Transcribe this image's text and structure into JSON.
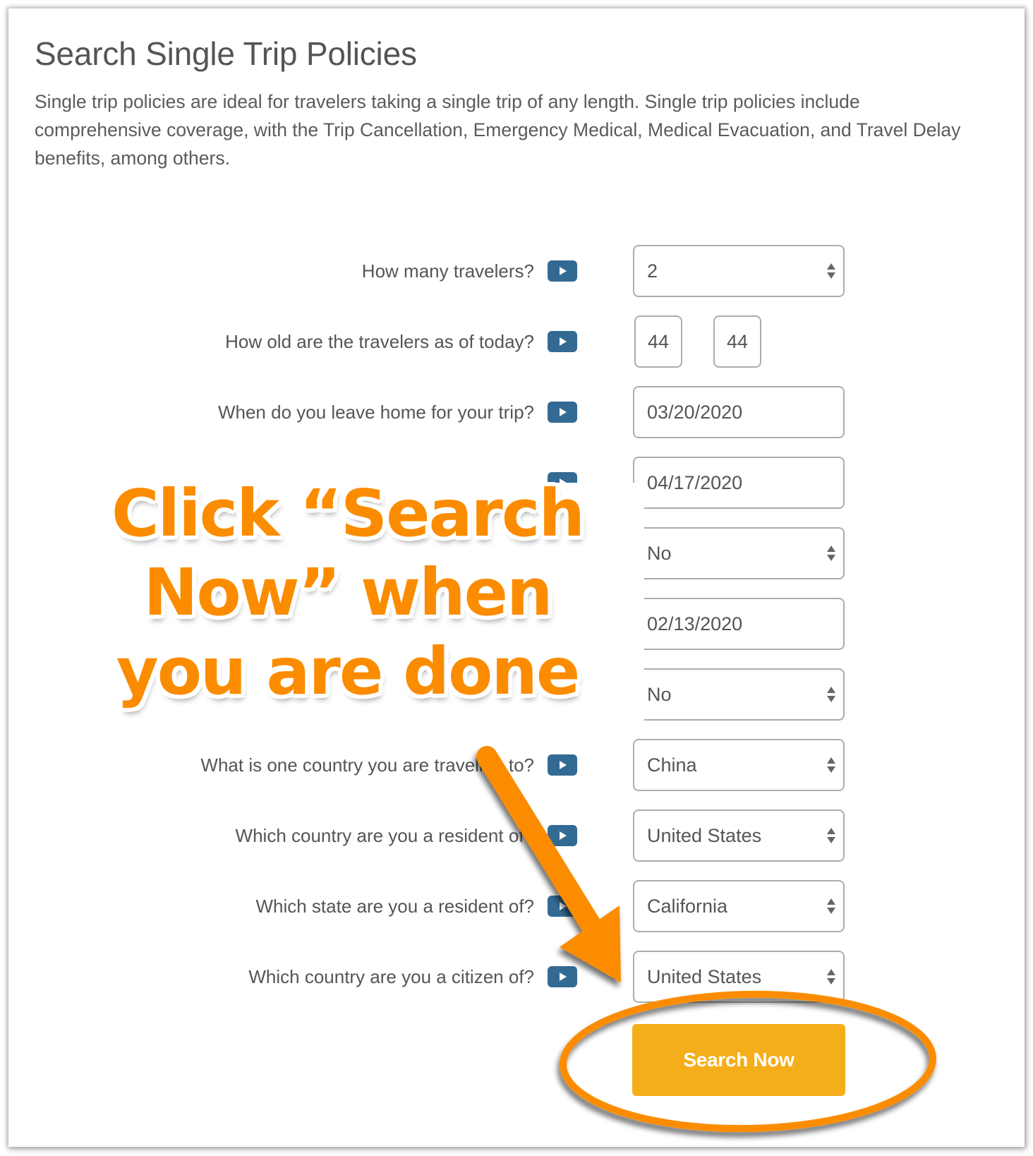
{
  "page": {
    "title": "Search Single Trip Policies",
    "description_lines": [
      "Single trip policies are ideal for travelers taking a single trip of any length. Single trip policies include",
      "comprehensive coverage, with the Trip Cancellation, Emergency Medical, Medical Evacuation, and Travel Delay",
      "benefits, among others."
    ]
  },
  "form": {
    "rows": [
      {
        "label": "How many travelers?",
        "label_visible": "How many travelers?",
        "type": "select",
        "value": "2"
      },
      {
        "label": "How old are the travelers as of today?",
        "label_visible": "How old are the travelers as of today?",
        "type": "ages",
        "values": [
          "44",
          "44"
        ]
      },
      {
        "label": "When do you leave home for your trip?",
        "label_visible": "When do you leave home for your trip?",
        "type": "text",
        "value": "03/20/2020"
      },
      {
        "label": "",
        "label_visible": "",
        "type": "text",
        "value": "04/17/2020"
      },
      {
        "label": "",
        "label_visible": "",
        "type": "select",
        "value": "No"
      },
      {
        "label": "",
        "label_visible": "",
        "type": "text",
        "value": "02/13/2020"
      },
      {
        "label": "",
        "label_visible": "",
        "type": "select",
        "value": "No"
      },
      {
        "label": "What is one country you are traveling to?",
        "label_visible": "What is one country you are traveling to?",
        "type": "select",
        "value": "China"
      },
      {
        "label": "Which country are you a resident of?",
        "label_visible": "Which country are you a resident of?",
        "type": "select",
        "value": "United States"
      },
      {
        "label": "Which state are you a resident of?",
        "label_visible": "Which state are you a resident of?",
        "type": "select",
        "value": "California"
      },
      {
        "label": "Which country are you a citizen of?",
        "label_visible": "Which country are you a citizen of?",
        "type": "select",
        "value": "United States"
      }
    ],
    "info_icon": "play-video-icon",
    "stepper_icon": "select-up-down-icon",
    "submit_label": "Search Now"
  },
  "annotation": {
    "callout_lines": [
      "Click “Search",
      "Now” when",
      "you are done"
    ],
    "arrow_icon": "arrow-pointer",
    "highlight_shape": "ellipse-highlight"
  },
  "colors": {
    "info_button": "#336a93",
    "submit_button": "#f4ae1a",
    "annotation_orange": "#fb8c00",
    "text": "#555555",
    "field_border": "#acacac"
  }
}
